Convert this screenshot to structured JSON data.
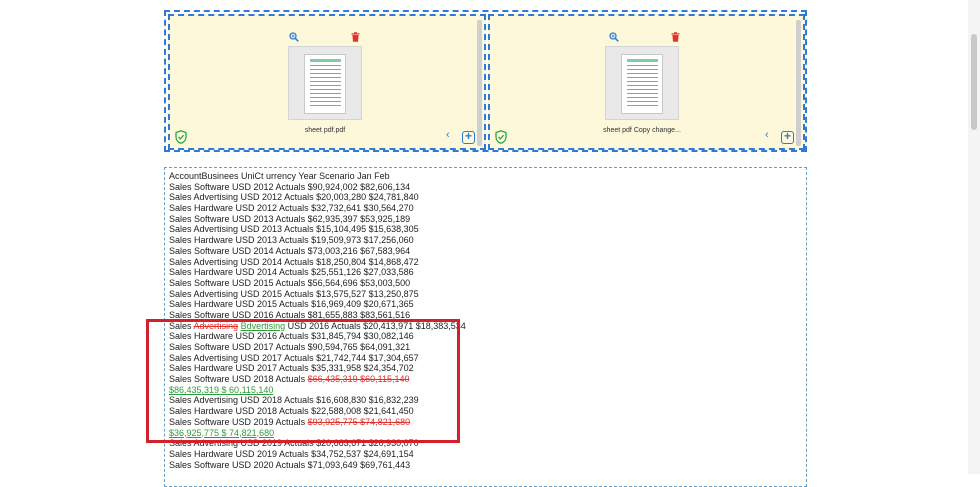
{
  "files": [
    {
      "name": "sheet pdf.pdf"
    },
    {
      "name": "sheet pdf Copy change..."
    }
  ],
  "colors": {
    "accent": "#2f7ad6",
    "panel_bg": "#fdf8da",
    "deleted": "#e0322f",
    "inserted": "#2f9d3a",
    "highlight": "#d4202a"
  },
  "comparison_lines": [
    {
      "parts": [
        {
          "t": "AccountBusinees UniCt urrency Year Scenario Jan Feb",
          "k": "n"
        }
      ]
    },
    {
      "parts": [
        {
          "t": "Sales Software USD 2012 Actuals $90,924,002 $82,606,134",
          "k": "n"
        }
      ]
    },
    {
      "parts": [
        {
          "t": "Sales Advertising USD 2012 Actuals $20,003,280 $24,781,840",
          "k": "n"
        }
      ]
    },
    {
      "parts": [
        {
          "t": "Sales Hardware USD 2012 Actuals $32,732,641 $30,564,270",
          "k": "n"
        }
      ]
    },
    {
      "parts": [
        {
          "t": "Sales Software USD 2013 Actuals $62,935,397 $53,925,189",
          "k": "n"
        }
      ]
    },
    {
      "parts": [
        {
          "t": "Sales Advertising USD 2013 Actuals $15,104,495 $15,638,305",
          "k": "n"
        }
      ]
    },
    {
      "parts": [
        {
          "t": "Sales Hardware USD 2013 Actuals $19,509,973 $17,256,060",
          "k": "n"
        }
      ]
    },
    {
      "parts": [
        {
          "t": "Sales Software USD 2014 Actuals $73,003,216 $67,583,964",
          "k": "n"
        }
      ]
    },
    {
      "parts": [
        {
          "t": "Sales Advertising USD 2014 Actuals $18,250,804 $14,868,472",
          "k": "n"
        }
      ]
    },
    {
      "parts": [
        {
          "t": "Sales Hardware USD 2014 Actuals $25,551,126 $27,033,586",
          "k": "n"
        }
      ]
    },
    {
      "parts": [
        {
          "t": "Sales Software USD 2015 Actuals $56,564,696 $53,003,500",
          "k": "n"
        }
      ]
    },
    {
      "parts": [
        {
          "t": "Sales Advertising USD 2015 Actuals $13,575,527 $13,250,875",
          "k": "n"
        }
      ]
    },
    {
      "parts": [
        {
          "t": "Sales Hardware USD 2015 Actuals $16,969,409 $20,671,365",
          "k": "n"
        }
      ]
    },
    {
      "parts": [
        {
          "t": "Sales Software USD 2016 Actuals $81,655,883 $83,561,516",
          "k": "n"
        }
      ]
    },
    {
      "parts": [
        {
          "t": "Sales ",
          "k": "n"
        },
        {
          "t": "Advertising",
          "k": "d"
        },
        {
          "t": " ",
          "k": "n"
        },
        {
          "t": "Bdvertising",
          "k": "i"
        },
        {
          "t": " USD 2016 Actuals $20,413,971 $18,383,534",
          "k": "n"
        }
      ]
    },
    {
      "parts": [
        {
          "t": "Sales Hardware USD 2016 Actuals $31,845,794 $30,082,146",
          "k": "n"
        }
      ]
    },
    {
      "parts": [
        {
          "t": "Sales Software USD 2017 Actuals $90,594,765 $64,091,321",
          "k": "n"
        }
      ]
    },
    {
      "parts": [
        {
          "t": "Sales Advertising USD 2017 Actuals $21,742,744 $17,304,657",
          "k": "n"
        }
      ]
    },
    {
      "parts": [
        {
          "t": "Sales Hardware USD 2017 Actuals $35,331,958 $24,354,702",
          "k": "n"
        }
      ]
    },
    {
      "parts": [
        {
          "t": "Sales Software USD 2018 Actuals ",
          "k": "n"
        },
        {
          "t": "$66,435,319 $60,115,140",
          "k": "d"
        }
      ]
    },
    {
      "parts": [
        {
          "t": "$86,435,319 $ 60,115,140",
          "k": "i"
        }
      ]
    },
    {
      "parts": [
        {
          "t": "Sales Advertising USD 2018 Actuals $16,608,830 $16,832,239",
          "k": "n"
        }
      ]
    },
    {
      "parts": [
        {
          "t": "Sales Hardware USD 2018 Actuals $22,588,008 $21,641,450",
          "k": "n"
        }
      ]
    },
    {
      "parts": [
        {
          "t": "Sales Software USD 2019 Actuals ",
          "k": "n"
        },
        {
          "t": "$93,925,775 $74,821,680",
          "k": "d"
        }
      ]
    },
    {
      "parts": [
        {
          "t": "$36,925,775 $ 74,821,680",
          "k": "i"
        }
      ]
    },
    {
      "parts": [
        {
          "t": "Sales Advertising USD 2019 Actuals $20,663,671 $20,930,070",
          "k": "n"
        }
      ]
    },
    {
      "parts": [
        {
          "t": "Sales Hardware USD 2019 Actuals $34,752,537 $24,691,154",
          "k": "n"
        }
      ]
    },
    {
      "parts": [
        {
          "t": "Sales Software USD 2020 Actuals $71,093,649 $69,761,443",
          "k": "n"
        }
      ]
    }
  ]
}
